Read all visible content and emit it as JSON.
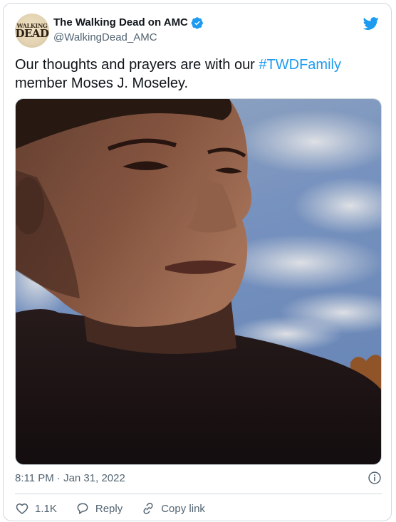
{
  "account": {
    "display_name": "The Walking Dead on AMC",
    "handle": "@WalkingDead_AMC",
    "avatar_logo_top": "WALKING",
    "avatar_logo_bottom": "DEAD"
  },
  "tweet": {
    "text_before": "Our thoughts and prayers are with our ",
    "hashtag": "#TWDFamily",
    "text_after": " member Moses J. Moseley.",
    "timestamp": "8:11 PM · Jan 31, 2022"
  },
  "actions": {
    "like_count": "1.1K",
    "reply_label": "Reply",
    "copy_link_label": "Copy link"
  },
  "icons": {
    "brand": "twitter-bird-icon",
    "verified": "verified-icon",
    "info": "info-icon",
    "like": "heart-icon",
    "reply": "speech-bubble-icon",
    "copy_link": "link-icon"
  },
  "colors": {
    "brand_blue": "#1d9bf0",
    "like_red": "#f91880",
    "text_primary": "#0f1419",
    "text_secondary": "#536471",
    "border": "#cfd9de"
  }
}
